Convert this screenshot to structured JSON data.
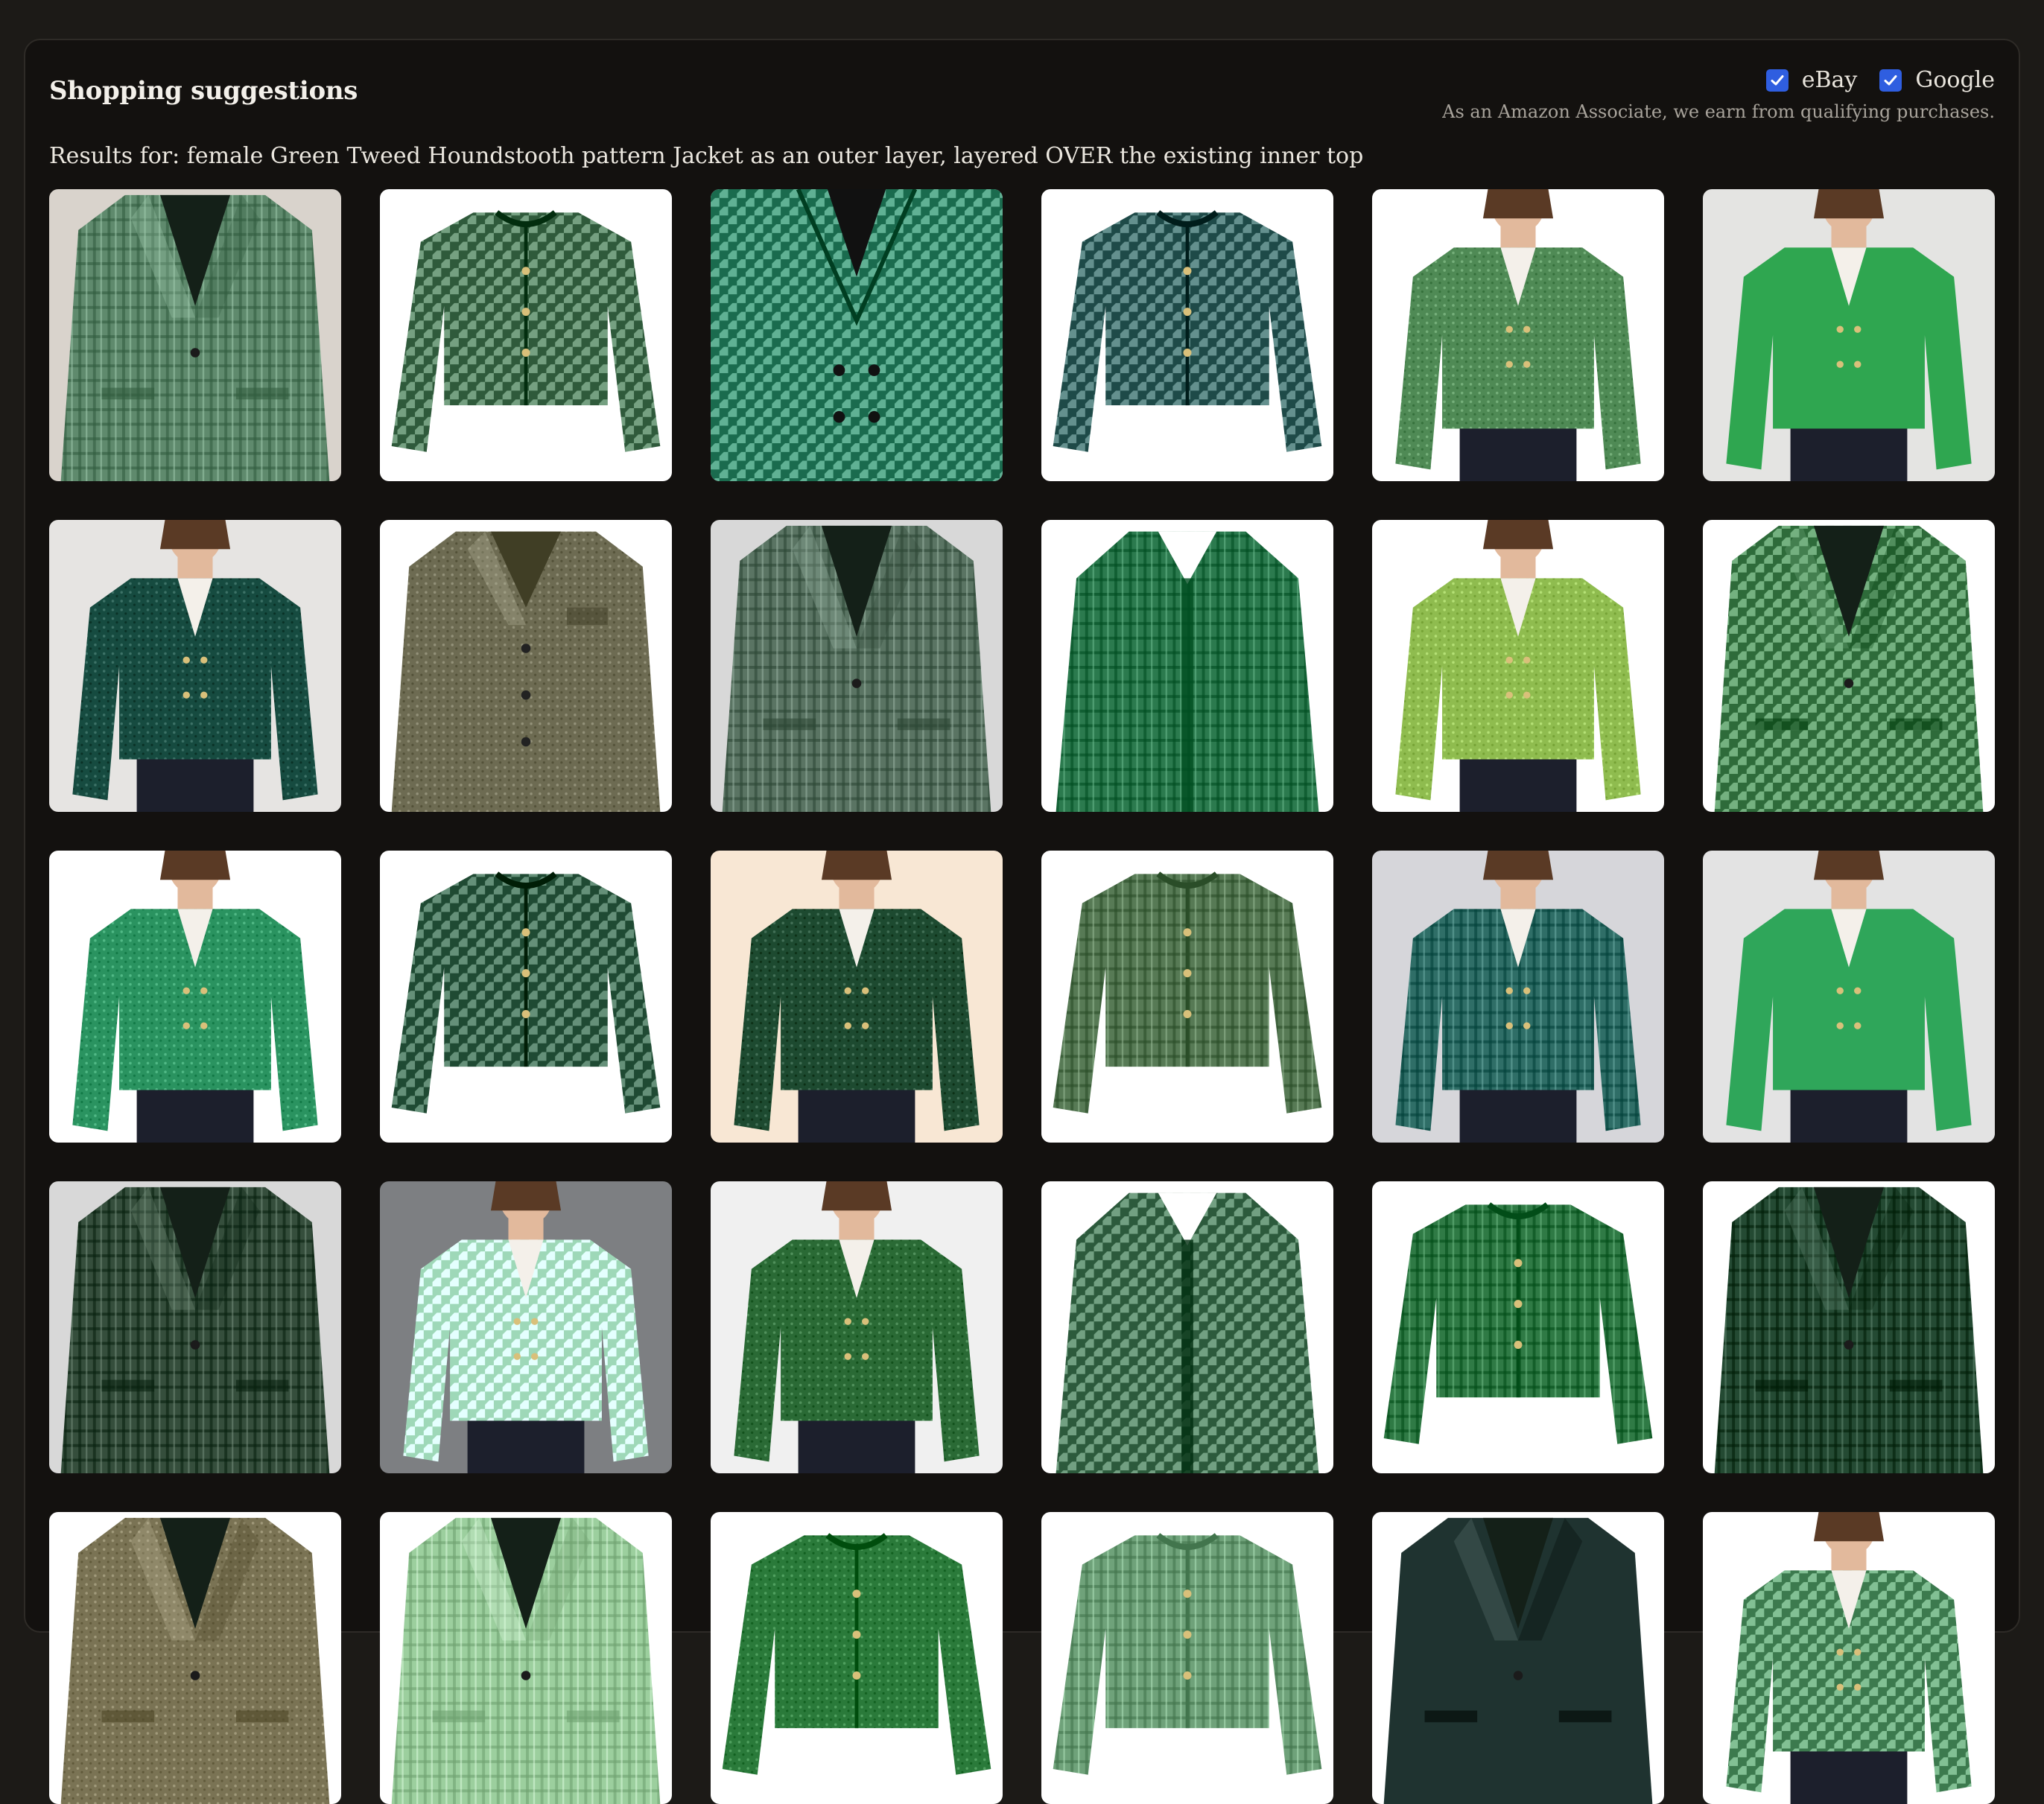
{
  "panel": {
    "title": "Shopping suggestions",
    "filters": [
      {
        "label": "eBay",
        "checked": true
      },
      {
        "label": "Google",
        "checked": true
      }
    ],
    "disclaimer": "As an Amazon Associate, we earn from qualifying purchases.",
    "results_label": "Results for: female Green Tweed Houndstooth pattern Jacket as an outer layer, layered OVER the existing inner top"
  },
  "colors": {
    "checkbox": "#2f5ee0"
  },
  "products": [
    {
      "bg": "#d9d3cc",
      "jacket": "#5f8a6d",
      "style": "blazer",
      "pattern": "check"
    },
    {
      "bg": "#ffffff",
      "jacket": "#2f5a3b",
      "style": "cropped",
      "pattern": "houndstooth"
    },
    {
      "bg": "#f2f2f2",
      "jacket": "#1a6b4e",
      "style": "closeup",
      "pattern": "houndstooth"
    },
    {
      "bg": "#ffffff",
      "jacket": "#1e4a48",
      "style": "cropped",
      "pattern": "houndstooth"
    },
    {
      "bg": "#ffffff",
      "jacket": "#4f8a55",
      "style": "model",
      "pattern": "tweed"
    },
    {
      "bg": "#e4e4e2",
      "jacket": "#2fa650",
      "style": "model",
      "pattern": "solid"
    },
    {
      "bg": "#e6e4e2",
      "jacket": "#164b40",
      "style": "model",
      "pattern": "tweed"
    },
    {
      "bg": "#ffffff",
      "jacket": "#6d6b52",
      "style": "coat",
      "pattern": "tweed"
    },
    {
      "bg": "#d8d8d8",
      "jacket": "#5a7463",
      "style": "blazer",
      "pattern": "check"
    },
    {
      "bg": "#ffffff",
      "jacket": "#2b7a4e",
      "style": "long",
      "pattern": "check"
    },
    {
      "bg": "#ffffff",
      "jacket": "#8fbc4f",
      "style": "model",
      "pattern": "tweed"
    },
    {
      "bg": "#ffffff",
      "jacket": "#2e6b3a",
      "style": "blazer",
      "pattern": "houndstooth"
    },
    {
      "bg": "#ffffff",
      "jacket": "#2a9360",
      "style": "model",
      "pattern": "tweed"
    },
    {
      "bg": "#ffffff",
      "jacket": "#1f4a33",
      "style": "cropped",
      "pattern": "houndstooth"
    },
    {
      "bg": "#f8e7d4",
      "jacket": "#1d4a30",
      "style": "model",
      "pattern": "tweed"
    },
    {
      "bg": "#ffffff",
      "jacket": "#577a55",
      "style": "cropped",
      "pattern": "check"
    },
    {
      "bg": "#d6d6da",
      "jacket": "#2f6e67",
      "style": "model",
      "pattern": "check"
    },
    {
      "bg": "#e3e3e3",
      "jacket": "#2fa65a",
      "style": "model",
      "pattern": "solid"
    },
    {
      "bg": "#d8d8d8",
      "jacket": "#354e3c",
      "style": "blazer",
      "pattern": "check"
    },
    {
      "bg": "#7d7f82",
      "jacket": "#9ed8b8",
      "style": "model",
      "pattern": "houndstooth"
    },
    {
      "bg": "#f0f0f0",
      "jacket": "#2a6a35",
      "style": "model",
      "pattern": "tweed"
    },
    {
      "bg": "#ffffff",
      "jacket": "#2c5a3c",
      "style": "long",
      "pattern": "houndstooth"
    },
    {
      "bg": "#ffffff",
      "jacket": "#2f7a45",
      "style": "cropped",
      "pattern": "check"
    },
    {
      "bg": "#ffffff",
      "jacket": "#244a33",
      "style": "blazer",
      "pattern": "check"
    },
    {
      "bg": "#ffffff",
      "jacket": "#7a7354",
      "style": "blazer",
      "pattern": "tweed"
    },
    {
      "bg": "#ffffff",
      "jacket": "#9ccf9e",
      "style": "blazer",
      "pattern": "check"
    },
    {
      "bg": "#ffffff",
      "jacket": "#2a7a3a",
      "style": "cropped",
      "pattern": "tweed"
    },
    {
      "bg": "#ffffff",
      "jacket": "#6fa27a",
      "style": "cropped",
      "pattern": "check"
    },
    {
      "bg": "#ffffff",
      "jacket": "#1f3330",
      "style": "blazer",
      "pattern": "solid"
    },
    {
      "bg": "#ffffff",
      "jacket": "#3c7a4e",
      "style": "model",
      "pattern": "houndstooth"
    }
  ]
}
